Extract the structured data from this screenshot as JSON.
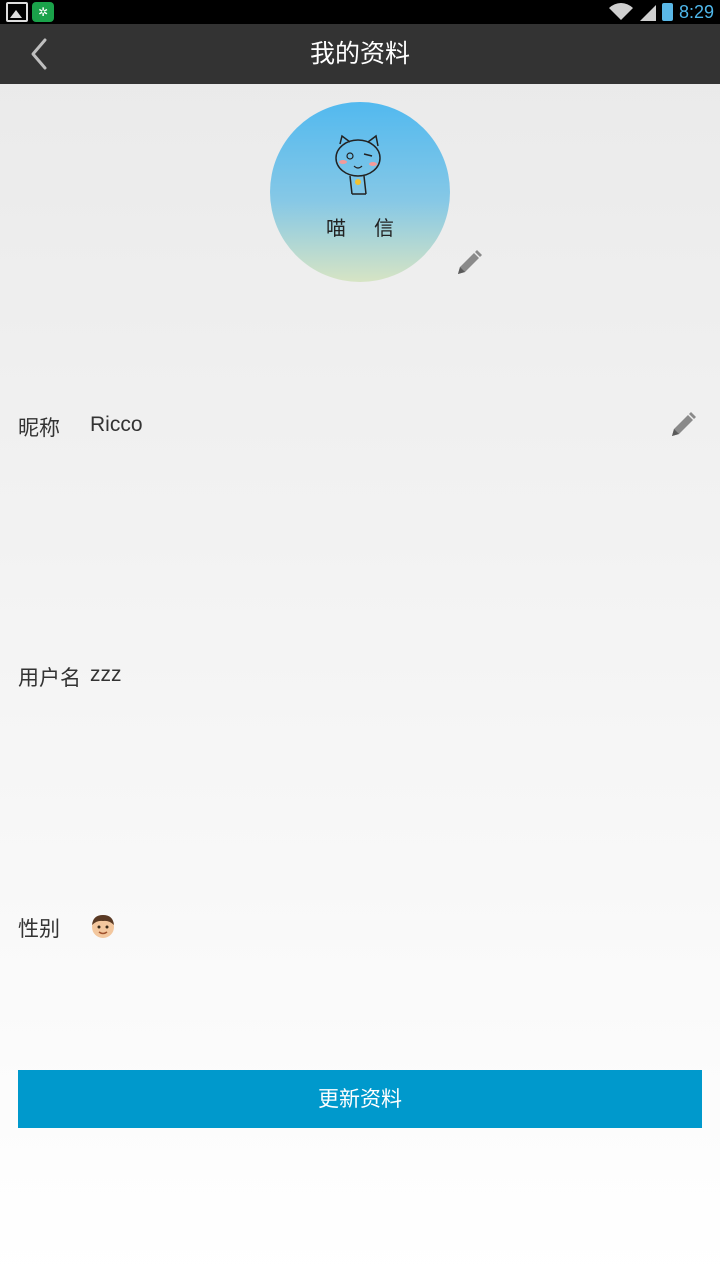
{
  "statusbar": {
    "time": "8:29",
    "icons": [
      "image-icon",
      "app-icon",
      "wifi-icon",
      "signal-icon",
      "battery-icon"
    ]
  },
  "appbar": {
    "title": "我的资料",
    "back_icon": "chevron-left-icon"
  },
  "profile": {
    "avatar_text": "喵信",
    "avatar_edit_icon": "pencil-icon",
    "nickname_label": "昵称",
    "nickname_value": "Ricco",
    "nickname_edit_icon": "pencil-icon",
    "username_label": "用户名",
    "username_value": "zzz",
    "gender_label": "性别",
    "gender_icon": "male-face-icon"
  },
  "actions": {
    "update_label": "更新资料"
  },
  "colors": {
    "appbar": "#333333",
    "accent_button": "#0099cc",
    "status_time": "#4fb7ea"
  }
}
